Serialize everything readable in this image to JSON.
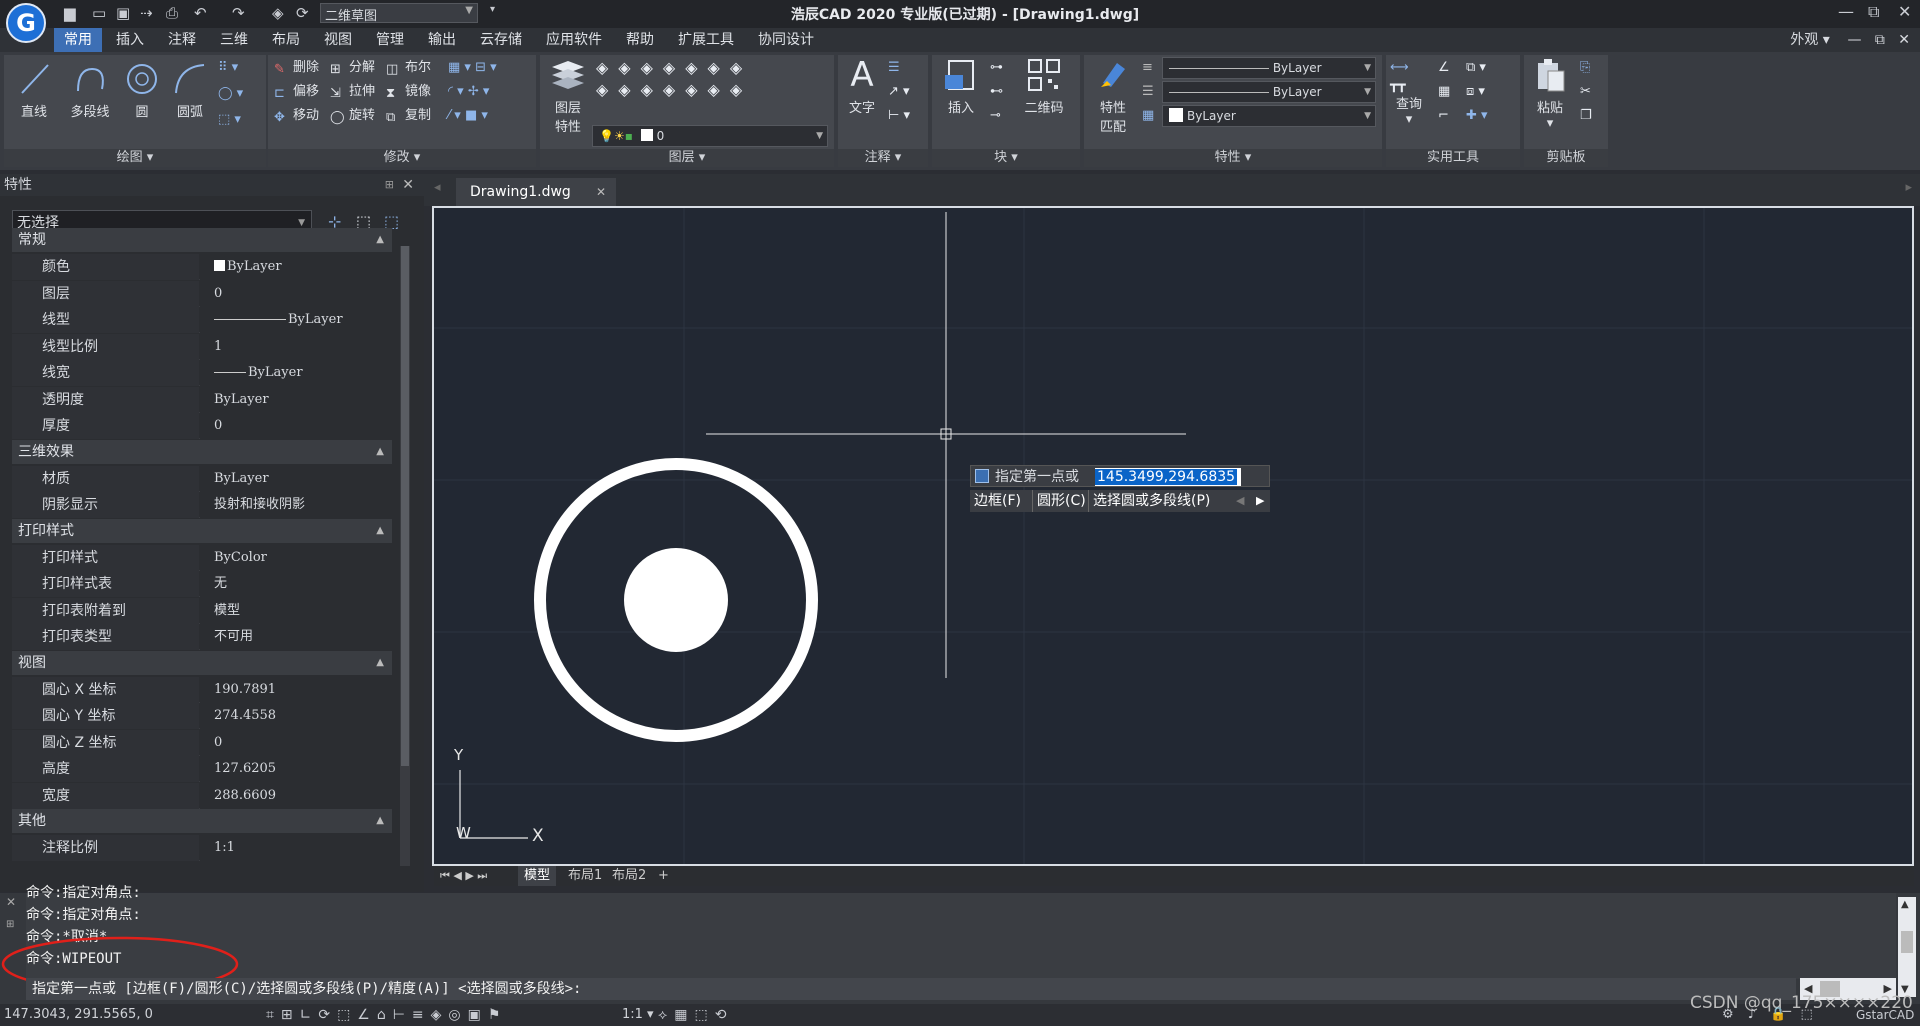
{
  "titlebar": {
    "logo_letter": "G",
    "workspace": "二维草图",
    "title": "浩辰CAD 2020 专业版(已过期) - [Drawing1.dwg]",
    "min": "—",
    "restore": "⧉",
    "close": "✕"
  },
  "menu": {
    "items": [
      "常用",
      "插入",
      "注释",
      "三维",
      "布局",
      "视图",
      "管理",
      "输出",
      "云存储",
      "应用软件",
      "帮助",
      "扩展工具",
      "协同设计"
    ],
    "right": "外观"
  },
  "ribbon": {
    "draw": {
      "title": "绘图",
      "line": "直线",
      "polyline": "多段线",
      "circle": "圆",
      "arc": "圆弧"
    },
    "modify": {
      "title": "修改",
      "erase": "删除",
      "explode": "分解",
      "boolean": "布尔",
      "offset": "偏移",
      "stretch": "拉伸",
      "mirror": "镜像",
      "move": "移动",
      "rotate": "旋转",
      "copy": "复制"
    },
    "layer": {
      "title": "图层",
      "props_line1": "图层",
      "props_line2": "特性",
      "current": "0"
    },
    "annot": {
      "title": "注释",
      "text": "文字"
    },
    "block": {
      "title": "块",
      "insert": "插入",
      "qr": "二维码"
    },
    "properties": {
      "title": "特性",
      "match_line1": "特性",
      "match_line2": "匹配",
      "linetype": "ByLayer",
      "lineweight": "ByLayer",
      "color": "ByLayer"
    },
    "utilities": {
      "title": "实用工具",
      "query": "查询"
    },
    "clipboard": {
      "title": "剪贴板",
      "paste": "粘贴"
    }
  },
  "props_panel": {
    "header": "特性",
    "selection": "无选择",
    "sections": [
      {
        "title": "常规",
        "rows": [
          [
            "颜色",
            "ByLayer"
          ],
          [
            "图层",
            "0"
          ],
          [
            "线型",
            "ByLayer"
          ],
          [
            "线型比例",
            "1"
          ],
          [
            "线宽",
            "ByLayer"
          ],
          [
            "透明度",
            "ByLayer"
          ],
          [
            "厚度",
            "0"
          ]
        ]
      },
      {
        "title": "三维效果",
        "rows": [
          [
            "材质",
            "ByLayer"
          ],
          [
            "阴影显示",
            "投射和接收阴影"
          ]
        ]
      },
      {
        "title": "打印样式",
        "rows": [
          [
            "打印样式",
            "ByColor"
          ],
          [
            "打印样式表",
            "无"
          ],
          [
            "打印表附着到",
            "模型"
          ],
          [
            "打印表类型",
            "不可用"
          ]
        ]
      },
      {
        "title": "视图",
        "rows": [
          [
            "圆心 X 坐标",
            "190.7891"
          ],
          [
            "圆心 Y 坐标",
            "274.4558"
          ],
          [
            "圆心 Z 坐标",
            "0"
          ],
          [
            "高度",
            "127.6205"
          ],
          [
            "宽度",
            "288.6609"
          ]
        ]
      },
      {
        "title": "其他",
        "rows": [
          [
            "注释比例",
            "1:1"
          ]
        ]
      }
    ]
  },
  "doc": {
    "tab": "Drawing1.dwg",
    "tab_close": "✕"
  },
  "canvas": {
    "ucs_y": "Y",
    "ucs_x": "X",
    "ucs_w": "W",
    "dyn_prompt": "指定第一点或",
    "dyn_value": "145.3499,294.6835",
    "dyn_opt1": "边框(F)",
    "dyn_opt2": "圆形(C)",
    "dyn_opt3": "选择圆或多段线(P)"
  },
  "layout_tabs": {
    "model": "模型",
    "layout1": "布局1",
    "layout2": "布局2",
    "add": "+"
  },
  "command": {
    "history": [
      "命令:指定对角点:",
      "命令:指定对角点:",
      "命令:*取消*",
      "命令:WIPEOUT"
    ],
    "input": "指定第一点或 [边框(F)/圆形(C)/选择圆或多段线(P)/精度(A)] <选择圆或多段线>:"
  },
  "status": {
    "coords": "147.3043, 291.5565, 0",
    "scale": "1:1",
    "watermark": "CSDN @qq_175××××220",
    "brand": "GstarCAD"
  },
  "colors": {
    "canvas_bg": "#222833",
    "accent": "#3d6fb5",
    "annotation_red": "#e0201a"
  }
}
